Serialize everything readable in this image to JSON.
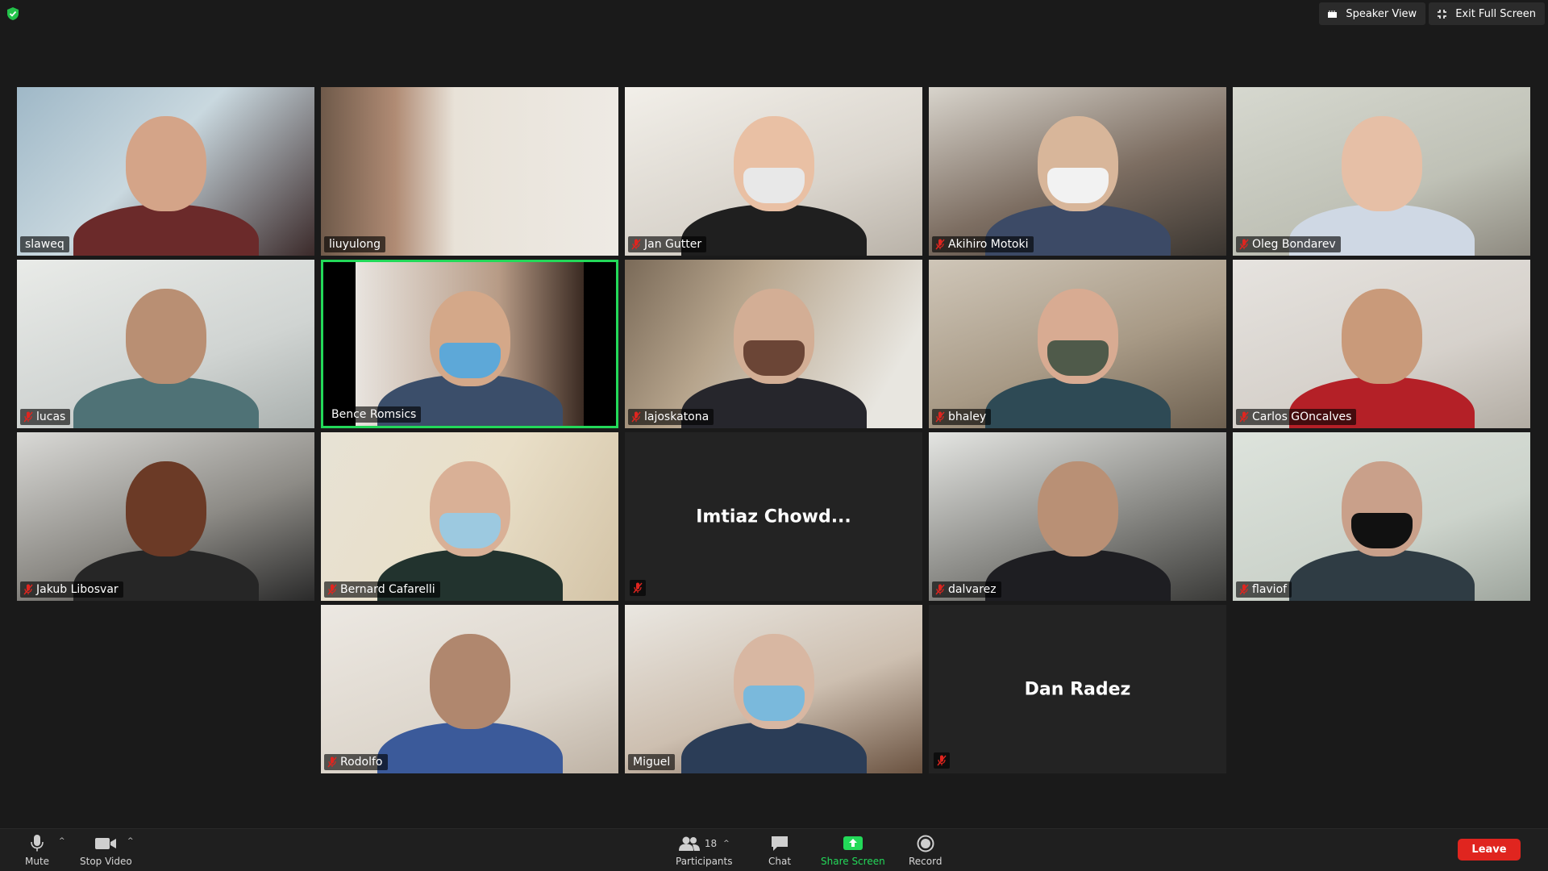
{
  "top_bar": {
    "speaker_view": "Speaker View",
    "exit_full_screen": "Exit Full Screen"
  },
  "participants": [
    {
      "name": "slaweq",
      "muted": false
    },
    {
      "name": "liuyulong",
      "muted": false
    },
    {
      "name": "Jan Gutter",
      "muted": true
    },
    {
      "name": "Akihiro Motoki",
      "muted": true
    },
    {
      "name": "Oleg Bondarev",
      "muted": true
    },
    {
      "name": "lucas",
      "muted": true
    },
    {
      "name": "Bence Romsics",
      "muted": false,
      "active_speaker": true
    },
    {
      "name": "lajoskatona",
      "muted": true
    },
    {
      "name": "bhaley",
      "muted": true
    },
    {
      "name": "Carlos GOncalves",
      "muted": true
    },
    {
      "name": "Jakub Libosvar",
      "muted": true
    },
    {
      "name": "Bernard Cafarelli",
      "muted": true
    },
    {
      "name": "Imtiaz Chowd...",
      "muted": true,
      "video_off": true
    },
    {
      "name": "dalvarez",
      "muted": true
    },
    {
      "name": "flaviof",
      "muted": true
    },
    {
      "name": "Rodolfo",
      "muted": true
    },
    {
      "name": "Miguel",
      "muted": false
    },
    {
      "name": "Dan Radez",
      "muted": true,
      "video_off": true
    }
  ],
  "toolbar": {
    "mute": "Mute",
    "stop_video": "Stop Video",
    "participants": "Participants",
    "participants_count": "18",
    "chat": "Chat",
    "share_screen": "Share Screen",
    "record": "Record",
    "leave": "Leave"
  },
  "colors": {
    "background": "#1a1a1a",
    "active_speaker_border": "#23d959",
    "share_screen": "#23d959",
    "leave": "#e0251f",
    "mute_icon": "#e0251f"
  }
}
